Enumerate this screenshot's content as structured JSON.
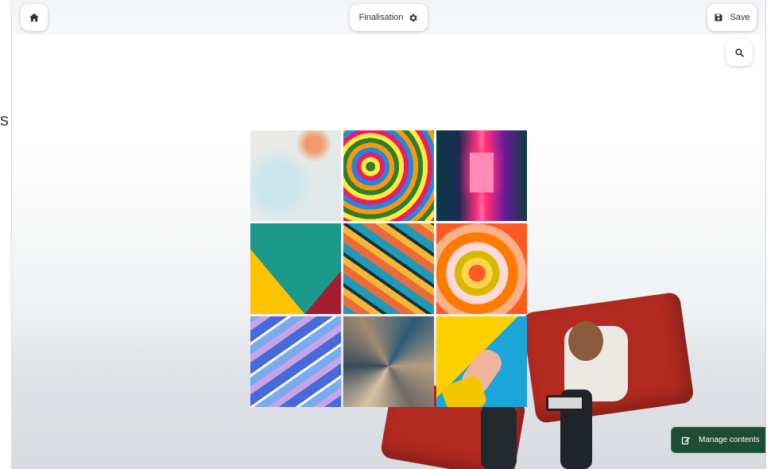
{
  "left_panel": {
    "partial_text": "s"
  },
  "toolbar": {
    "home_icon": "home-icon",
    "mode_label": "Finalisation",
    "mode_icon": "gear-icon",
    "save_label": "Save",
    "save_icon": "floppy-disk-icon",
    "search_icon": "search-icon"
  },
  "gallery": {
    "tiles": [
      {
        "name": "pastel-watercolor-tile",
        "colors": [
          "#e7e7e2",
          "#d7e9ef",
          "#f09a6b"
        ]
      },
      {
        "name": "psychedelic-swirl-tile",
        "colors": [
          "#2e7d32",
          "#e91e63",
          "#ffeb3b",
          "#1e88e5"
        ]
      },
      {
        "name": "neon-corridor-tile",
        "colors": [
          "#0b3b45",
          "#ff2f7a",
          "#6a1b9a"
        ]
      },
      {
        "name": "geometric-cone-tile",
        "colors": [
          "#3a0ca3",
          "#ffc300",
          "#1b998b",
          "#a51c30"
        ]
      },
      {
        "name": "feathers-tile",
        "colors": [
          "#1f9bb8",
          "#e96b3a",
          "#f6b733",
          "#17323f"
        ]
      },
      {
        "name": "concentric-rings-tile",
        "colors": [
          "#ff5a1f",
          "#ffd8d8",
          "#d7b900",
          "#ff7a00"
        ]
      },
      {
        "name": "blue-marble-tile",
        "colors": [
          "#4a69d8",
          "#c7a4e8",
          "#7aaaf0"
        ]
      },
      {
        "name": "metallic-shards-tile",
        "colors": [
          "#2d5b78",
          "#b59c7e",
          "#6e6a66"
        ]
      },
      {
        "name": "yellow-hand-tile",
        "colors": [
          "#ffd000",
          "#1aa6d8",
          "#f0b49a"
        ]
      }
    ]
  },
  "footer": {
    "manage_label": "Manage contents",
    "manage_icon": "edit-icon",
    "accent": "#1e4d36"
  }
}
